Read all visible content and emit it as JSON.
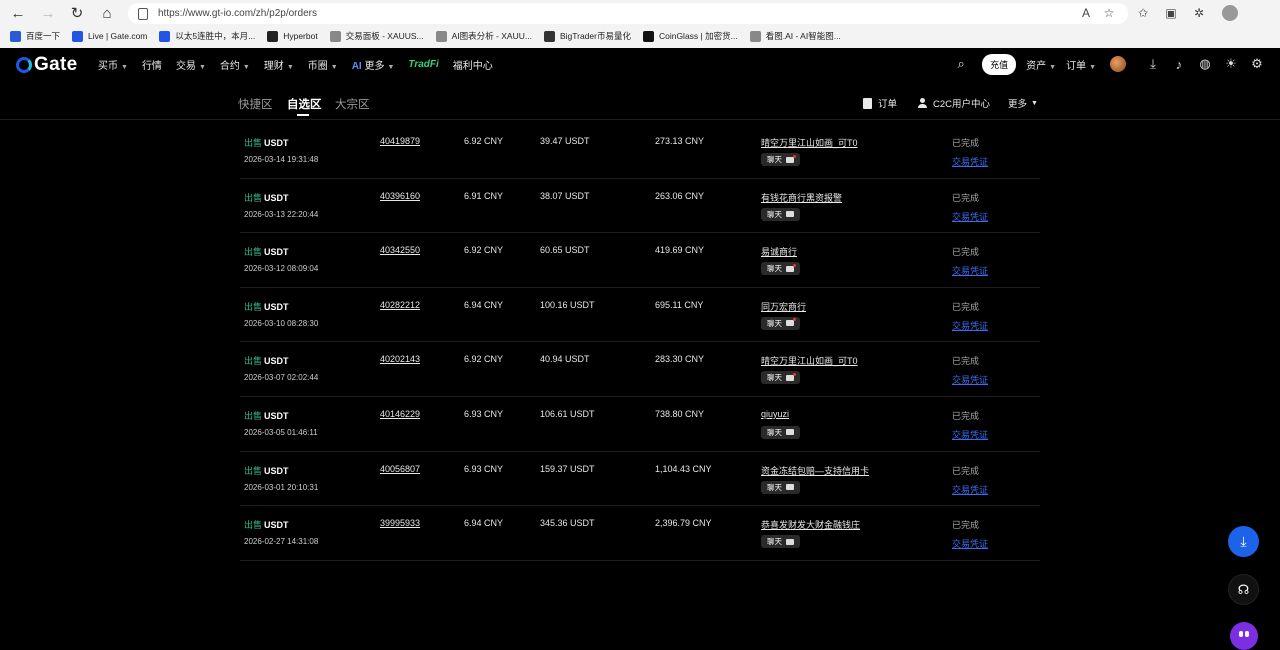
{
  "browser": {
    "url": "https://www.gt-io.com/zh/p2p/orders",
    "bookmarks": [
      {
        "label": "百度一下",
        "color": "#2a5bd7"
      },
      {
        "label": "Live | Gate.com",
        "color": "#2354e6"
      },
      {
        "label": "以太5连胜中，本月...",
        "color": "#2354e6"
      },
      {
        "label": "Hyperbot",
        "color": "#222222"
      },
      {
        "label": "交易面板 - XAUUS...",
        "color": "#888888"
      },
      {
        "label": "AI图表分析 - XAUU...",
        "color": "#888888"
      },
      {
        "label": "BigTrader币易量化",
        "color": "#333333"
      },
      {
        "label": "CoinGlass | 加密货...",
        "color": "#111111"
      },
      {
        "label": "看图.AI - AI智能图...",
        "color": "#888888"
      }
    ]
  },
  "header": {
    "logo": "Gate",
    "menu": [
      {
        "label": "买币",
        "caret": true
      },
      {
        "label": "行情",
        "caret": false
      },
      {
        "label": "交易",
        "caret": true
      },
      {
        "label": "合约",
        "caret": true
      },
      {
        "label": "理财",
        "caret": true
      },
      {
        "label": "币圈",
        "caret": true
      },
      {
        "label": "更多",
        "caret": true,
        "prefix": "AI"
      },
      {
        "label": "TradFi",
        "caret": false
      },
      {
        "label": "福利中心",
        "caret": false
      }
    ],
    "deposit_label": "充值",
    "assets_label": "资产",
    "orders_label": "订单"
  },
  "subnav": {
    "tabs": [
      "快捷区",
      "自选区",
      "大宗区"
    ],
    "active_tab": 1,
    "orders_link": "订单",
    "c2c_link": "C2C用户中心",
    "more_link": "更多"
  },
  "orders": [
    {
      "side": "出售",
      "asset": "USDT",
      "time": "2026-03-14 19:31:48",
      "id": "40419879",
      "price": "6.92 CNY",
      "qty": "39.47 USDT",
      "total": "273.13 CNY",
      "merchant": "晴空万里江山如画_可T0",
      "chat": "聊天",
      "unread": true,
      "status": "已完成",
      "proof": "交易凭证"
    },
    {
      "side": "出售",
      "asset": "USDT",
      "time": "2026-03-13 22:20:44",
      "id": "40396160",
      "price": "6.91 CNY",
      "qty": "38.07 USDT",
      "total": "263.06 CNY",
      "merchant": "有钱花商行黑资报警",
      "chat": "聊天",
      "unread": false,
      "status": "已完成",
      "proof": "交易凭证"
    },
    {
      "side": "出售",
      "asset": "USDT",
      "time": "2026-03-12 08:09:04",
      "id": "40342550",
      "price": "6.92 CNY",
      "qty": "60.65 USDT",
      "total": "419.69 CNY",
      "merchant": "易诚商行",
      "chat": "聊天",
      "unread": true,
      "status": "已完成",
      "proof": "交易凭证"
    },
    {
      "side": "出售",
      "asset": "USDT",
      "time": "2026-03-10 08:28:30",
      "id": "40282212",
      "price": "6.94 CNY",
      "qty": "100.16 USDT",
      "total": "695.11 CNY",
      "merchant": "同万宏商行",
      "chat": "聊天",
      "unread": true,
      "status": "已完成",
      "proof": "交易凭证"
    },
    {
      "side": "出售",
      "asset": "USDT",
      "time": "2026-03-07 02:02:44",
      "id": "40202143",
      "price": "6.92 CNY",
      "qty": "40.94 USDT",
      "total": "283.30 CNY",
      "merchant": "晴空万里江山如画_可T0",
      "chat": "聊天",
      "unread": true,
      "status": "已完成",
      "proof": "交易凭证"
    },
    {
      "side": "出售",
      "asset": "USDT",
      "time": "2026-03-05 01:46:11",
      "id": "40146229",
      "price": "6.93 CNY",
      "qty": "106.61 USDT",
      "total": "738.80 CNY",
      "merchant": "qiuyuzi",
      "chat": "聊天",
      "unread": false,
      "status": "已完成",
      "proof": "交易凭证"
    },
    {
      "side": "出售",
      "asset": "USDT",
      "time": "2026-03-01 20:10:31",
      "id": "40056807",
      "price": "6.93 CNY",
      "qty": "159.37 USDT",
      "total": "1,104.43 CNY",
      "merchant": "资金冻结包赔—支持信用卡",
      "chat": "聊天",
      "unread": false,
      "status": "已完成",
      "proof": "交易凭证"
    },
    {
      "side": "出售",
      "asset": "USDT",
      "time": "2026-02-27 14:31:08",
      "id": "39995933",
      "price": "6.94 CNY",
      "qty": "345.36 USDT",
      "total": "2,396.79 CNY",
      "merchant": "恭喜发财发大财金融钱庄",
      "chat": "聊天",
      "unread": false,
      "status": "已完成",
      "proof": "交易凭证"
    }
  ]
}
